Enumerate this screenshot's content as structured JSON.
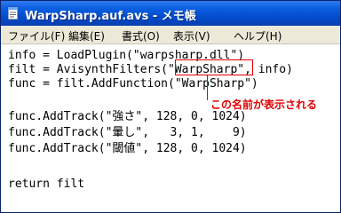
{
  "window": {
    "title": "WarpSharp.auf.avs - メモ帳"
  },
  "menubar": {
    "items": [
      {
        "label": "ファイル(F)"
      },
      {
        "label": "編集(E)"
      },
      {
        "label": "書式(O)"
      },
      {
        "label": "表示(V)"
      },
      {
        "label": "ヘルプ(H)"
      }
    ]
  },
  "editor": {
    "lines": [
      "info = LoadPlugin(\"warpsharp.dll\")",
      "filt = AvisynthFilters(\"WarpSharp\", info)",
      "func = filt.AddFunction(\"WarpSharp\")",
      "",
      "func.AddTrack(\"強さ\", 128, 0, 1024)",
      "func.AddTrack(\"暈し\",   3, 1,    9)",
      "func.AddTrack(\"閾値\", 128, 0, 1024)",
      "",
      "return filt"
    ]
  },
  "annotation": {
    "text": "この名前が表示される",
    "color": "#e00000"
  },
  "colors": {
    "titlebar": "#0a5fe0",
    "menubar": "#ece9d8",
    "accent_red": "#e00000"
  }
}
